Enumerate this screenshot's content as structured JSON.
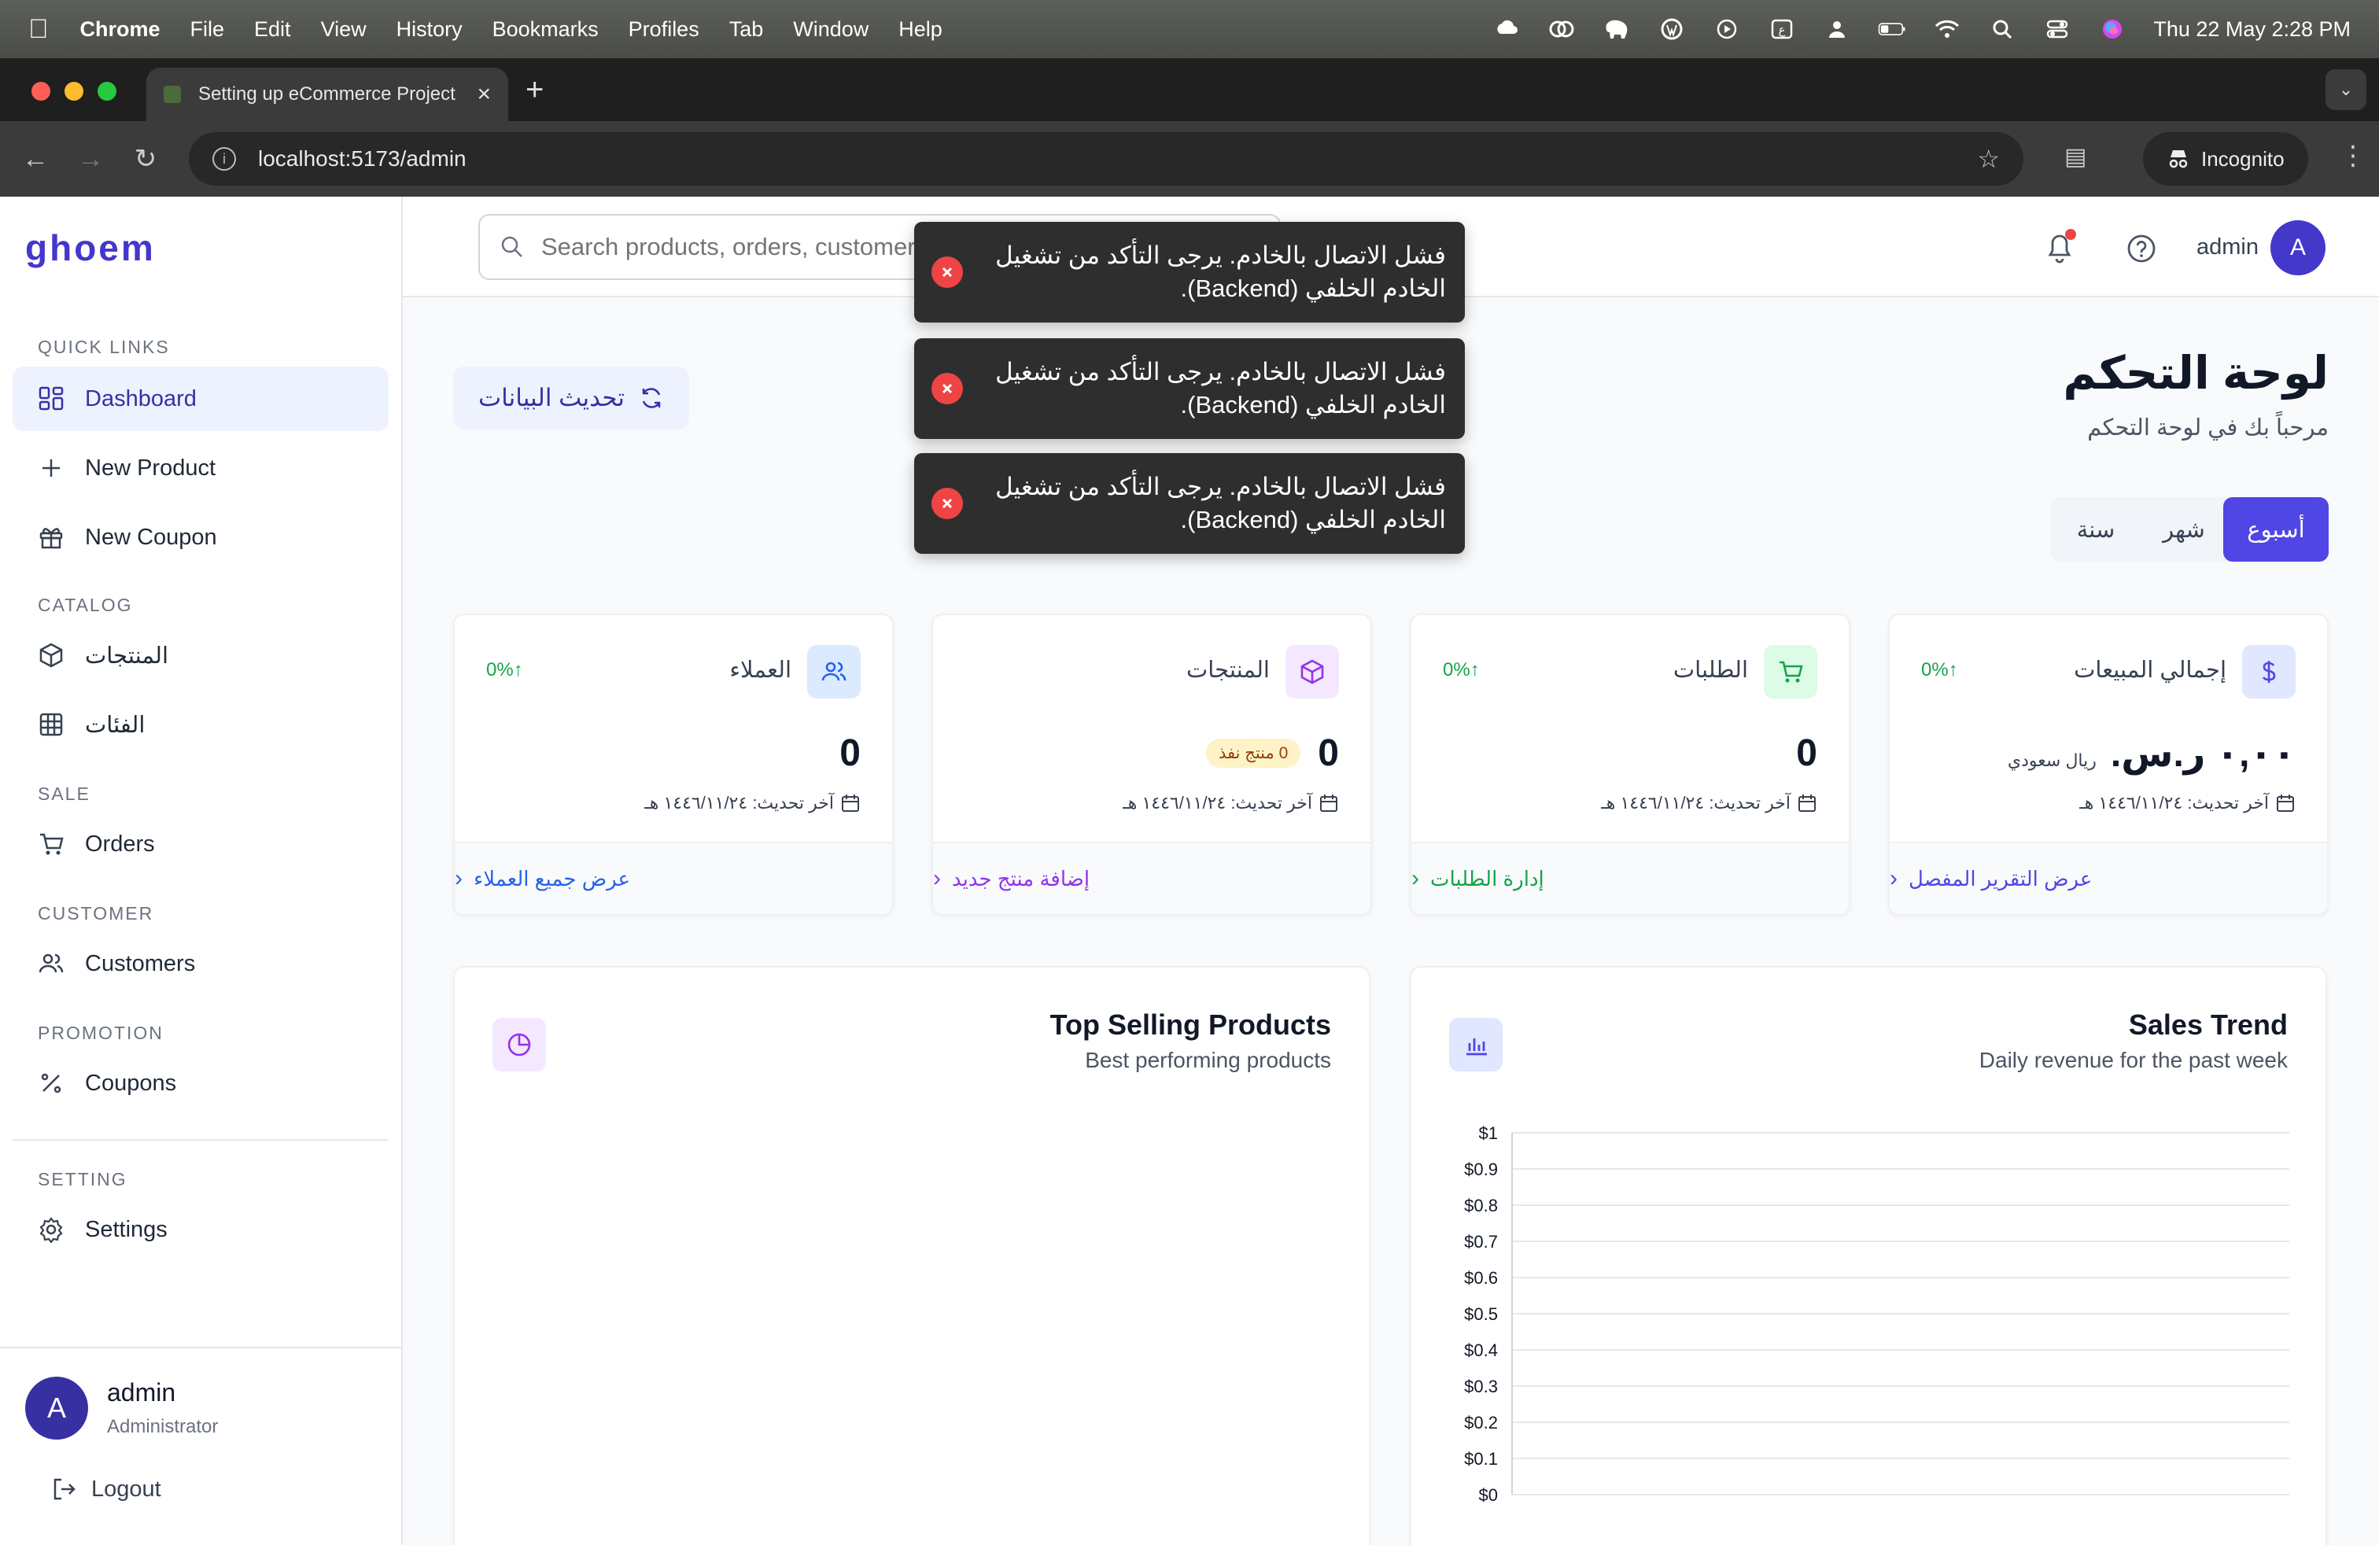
{
  "menubar": {
    "items": [
      "Chrome",
      "File",
      "Edit",
      "View",
      "History",
      "Bookmarks",
      "Profiles",
      "Tab",
      "Window",
      "Help"
    ],
    "datetime": "Thu 22 May  2:28 PM"
  },
  "browser": {
    "tab_title": "Setting up eCommerce Project",
    "url": "localhost:5173/admin",
    "incognito_label": "Incognito"
  },
  "sidebar": {
    "logo": "ghoem",
    "sections": {
      "quick_links": "QUICK LINKS",
      "catalog": "CATALOG",
      "sale": "SALE",
      "customer": "CUSTOMER",
      "promotion": "PROMOTION",
      "setting": "SETTING"
    },
    "items": {
      "dashboard": "Dashboard",
      "new_product": "New Product",
      "new_coupon": "New Coupon",
      "products": "المنتجات",
      "categories": "الفئات",
      "orders": "Orders",
      "customers": "Customers",
      "coupons": "Coupons",
      "settings": "Settings"
    },
    "user": {
      "avatar_letter": "A",
      "name": "admin",
      "role": "Administrator",
      "logout": "Logout"
    }
  },
  "topbar": {
    "search_placeholder": "Search products, orders, customers...",
    "user_name": "admin",
    "avatar_letter": "A"
  },
  "toasts": [
    "فشل الاتصال بالخادم. يرجى التأكد من تشغيل الخادم الخلفي (Backend).",
    "فشل الاتصال بالخادم. يرجى التأكد من تشغيل الخادم الخلفي (Backend).",
    "فشل الاتصال بالخادم. يرجى التأكد من تشغيل الخادم الخلفي (Backend)."
  ],
  "header": {
    "title": "لوحة التحكم",
    "subtitle": "مرحباً بك في لوحة التحكم",
    "refresh_label": "تحديث البيانات",
    "periods": [
      "أسبوع",
      "شهر",
      "سنة"
    ],
    "active_period": "أسبوع"
  },
  "cards": [
    {
      "label": "إجمالي المبيعات",
      "value": "٠,٠٠ ر.س.",
      "unit": "ريال سعودي",
      "pct": "0%",
      "updated": "آخر تحديث: ١٤٤٦/١١/٢٤ هـ",
      "link": "عرض التقرير المفصل",
      "color": "#4f46e5",
      "icon_bg": "#e0e7ff"
    },
    {
      "label": "الطلبات",
      "value": "0",
      "pct": "0%",
      "updated": "آخر تحديث: ١٤٤٦/١١/٢٤ هـ",
      "link": "إدارة الطلبات",
      "color": "#16a34a",
      "icon_bg": "#dcfce7"
    },
    {
      "label": "المنتجات",
      "value": "0",
      "badge": "0 منتج نفذ",
      "pct": "",
      "updated": "آخر تحديث: ١٤٤٦/١١/٢٤ هـ",
      "link": "إضافة منتج جديد",
      "color": "#9333ea",
      "icon_bg": "#f3e8ff"
    },
    {
      "label": "العملاء",
      "value": "0",
      "pct": "0%",
      "updated": "آخر تحديث: ١٤٤٦/١١/٢٤ هـ",
      "link": "عرض جميع العملاء",
      "color": "#2563eb",
      "icon_bg": "#dbeafe"
    }
  ],
  "panels": {
    "top_selling": {
      "title": "Top Selling Products",
      "subtitle": "Best performing products"
    },
    "sales_trend": {
      "title": "Sales Trend",
      "subtitle": "Daily revenue for the past week"
    }
  },
  "chart_data": {
    "type": "line",
    "title": "Sales Trend",
    "subtitle": "Daily revenue for the past week",
    "xlabel": "",
    "ylabel": "",
    "ylim": [
      0,
      1
    ],
    "y_ticks": [
      "$1",
      "$0.9",
      "$0.8",
      "$0.7",
      "$0.6",
      "$0.5",
      "$0.4",
      "$0.3",
      "$0.2",
      "$0.1",
      "$0"
    ],
    "series": [],
    "grid": true
  }
}
